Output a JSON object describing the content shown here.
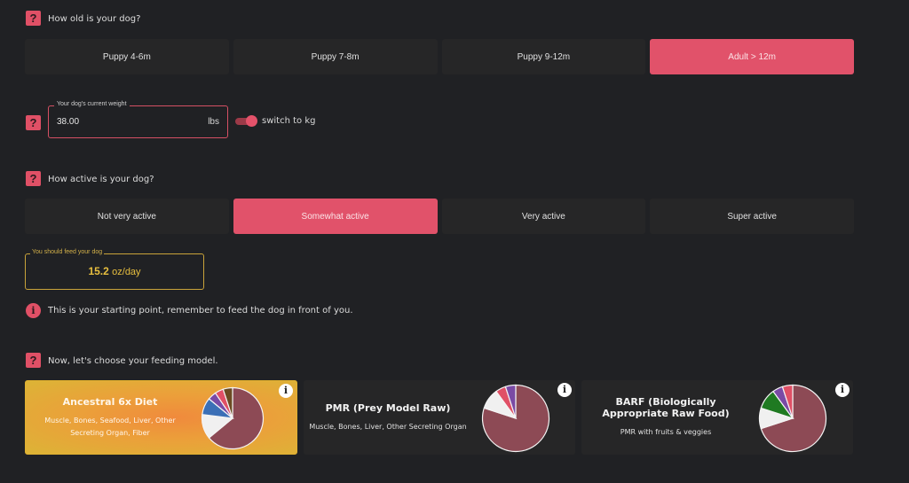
{
  "age": {
    "question": "How old is your dog?",
    "options": [
      "Puppy 4-6m",
      "Puppy 7-8m",
      "Puppy 9-12m",
      "Adult > 12m"
    ],
    "selected_index": 3
  },
  "weight": {
    "legend": "Your dog's current weight",
    "value": "38.00",
    "unit": "lbs",
    "toggle_label": "switch to kg",
    "toggle_on": true
  },
  "activity": {
    "question": "How active is your dog?",
    "options": [
      "Not very active",
      "Somewhat active",
      "Very active",
      "Super active"
    ],
    "selected_index": 1
  },
  "feed": {
    "legend": "You should feed your dog",
    "amount": "15.2",
    "unit": "oz/day",
    "note": "This is your starting point, remember to feed the dog in front of you."
  },
  "model": {
    "question": "Now, let's choose your feeding model.",
    "cards": [
      {
        "title": "Ancestral 6x Diet",
        "description": "Muscle, Bones, Seafood, Liver, Other Secreting Organ, Fiber",
        "selected": true,
        "pie": [
          {
            "label": "Muscle",
            "value": 64,
            "color": "#8d4a55"
          },
          {
            "label": "Bones",
            "value": 13,
            "color": "#f0f0f0"
          },
          {
            "label": "Seafood",
            "value": 9,
            "color": "#3b6fb6"
          },
          {
            "label": "Liver",
            "value": 4.5,
            "color": "#7a4aa5"
          },
          {
            "label": "Other Secreting Organ",
            "value": 4.5,
            "color": "#e05066"
          },
          {
            "label": "Fiber",
            "value": 5,
            "color": "#6b4a22"
          }
        ]
      },
      {
        "title": "PMR (Prey Model Raw)",
        "description": "Muscle, Bones, Liver, Other Secreting Organ",
        "selected": false,
        "pie": [
          {
            "label": "Muscle",
            "value": 80,
            "color": "#8d4a55"
          },
          {
            "label": "Bones",
            "value": 10,
            "color": "#f0f0f0"
          },
          {
            "label": "Liver",
            "value": 5,
            "color": "#e05066"
          },
          {
            "label": "Other Secreting Organ",
            "value": 5,
            "color": "#7a4aa5"
          }
        ]
      },
      {
        "title": "BARF (Biologically Appropriate Raw Food)",
        "description": "PMR with fruits & veggies",
        "selected": false,
        "pie": [
          {
            "label": "Muscle",
            "value": 70,
            "color": "#8d4a55"
          },
          {
            "label": "Bones",
            "value": 10,
            "color": "#f0f0f0"
          },
          {
            "label": "Vegetables",
            "value": 10,
            "color": "#1f7a22"
          },
          {
            "label": "Liver",
            "value": 5,
            "color": "#7a4aa5"
          },
          {
            "label": "Other Secreting Organ",
            "value": 5,
            "color": "#e05066"
          }
        ]
      }
    ]
  },
  "icons": {
    "help": "?",
    "info": "i"
  }
}
